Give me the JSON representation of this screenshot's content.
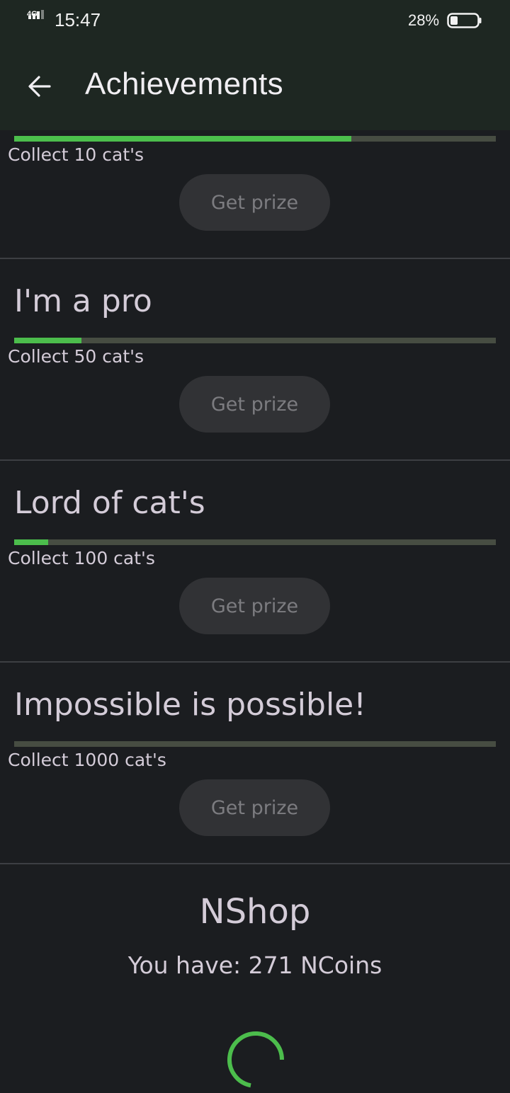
{
  "status_bar": {
    "network": "4G",
    "time": "15:47",
    "battery": "28%",
    "battery_level": 0.28
  },
  "app_bar": {
    "title": "Achievements",
    "back_icon": "arrow-back-icon"
  },
  "achievements": [
    {
      "title": "",
      "description": "Collect 10 cat's",
      "progress": 0.7,
      "button": "Get prize"
    },
    {
      "title": "I'm a pro",
      "description": "Collect 50 cat's",
      "progress": 0.14,
      "button": "Get prize"
    },
    {
      "title": "Lord of cat's",
      "description": "Collect 100 cat's",
      "progress": 0.07,
      "button": "Get prize"
    },
    {
      "title": "Impossible is possible!",
      "description": "Collect 1000 cat's",
      "progress": 0.0,
      "button": "Get prize"
    }
  ],
  "shop": {
    "title": "NShop",
    "balance": "You have: 271 NCoins",
    "loading_icon": "loading-spinner-icon"
  },
  "colors": {
    "bar_background": "#1e2722",
    "page_background": "#1b1d20",
    "progress_fill": "#4cbd4c",
    "progress_track": "#474d42",
    "button_background": "#313235",
    "text": "#d4ccd8"
  }
}
